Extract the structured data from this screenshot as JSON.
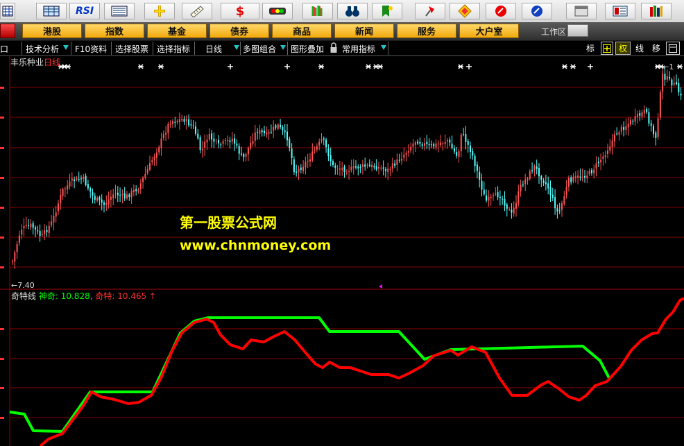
{
  "icon_toolbar": {
    "icons": [
      "grid-icon",
      "table-icon",
      "rsi-icon",
      "list-icon",
      "crosshair-icon",
      "ruler-icon",
      "dollar-icon",
      "traffic-light-icon",
      "bars-icon",
      "binoculars-icon",
      "bookmark-icon",
      "pin-icon",
      "diamond-icon",
      "info-ball-icon",
      "info-ball-icon",
      "window-icon",
      "report-icon",
      "books-icon"
    ],
    "rsi_label": "RSI",
    "dollar_label": "$"
  },
  "menu_bar": {
    "items": [
      "港股",
      "指数",
      "基金",
      "债券",
      "商品",
      "新闻",
      "服务",
      "大户室"
    ],
    "workspace": "工作区"
  },
  "function_bar": {
    "left_items": [
      "口",
      "技术分析",
      "F10资料",
      "选择股票",
      "选择指标",
      "日线",
      "多图组合",
      "图形叠加",
      "常用指标"
    ],
    "right_items": [
      "标",
      "权",
      "线",
      "移"
    ]
  },
  "main_chart": {
    "stock_name": "丰乐种业",
    "period": "日线",
    "low_marker": "←7.40",
    "high_marker": "←1"
  },
  "indicator": {
    "name": "奇特线",
    "shenqi_label": "神奇:",
    "shenqi_value": "10.828,",
    "qite_label": "奇特:",
    "qite_value": "10.465",
    "arrow": "↑"
  },
  "watermark": {
    "title": "第一股票公式网",
    "url": "www.chnmoney.com"
  },
  "colors": {
    "up_candle": "#ff5555",
    "down_candle": "#55ffff",
    "grid": "#880000",
    "line_shenqi": "#00ff00",
    "line_qite": "#ff0000",
    "watermark": "#ffff00",
    "menu_button": "#f6b820"
  }
}
